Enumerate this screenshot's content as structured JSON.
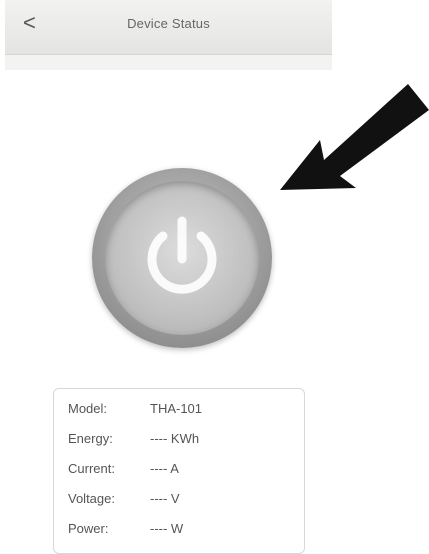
{
  "header": {
    "back_label": "<",
    "title": "Device Status"
  },
  "power_button": {
    "icon": "power-icon"
  },
  "annotation": {
    "icon": "arrow-pointer-icon",
    "color": "#111111"
  },
  "info": [
    {
      "label": "Model:",
      "value": "THA-101"
    },
    {
      "label": "Energy:",
      "value": "---- KWh"
    },
    {
      "label": "Current:",
      "value": "---- A"
    },
    {
      "label": "Voltage:",
      "value": "---- V"
    },
    {
      "label": "Power:",
      "value": "---- W"
    }
  ],
  "colors": {
    "header_bg": "#e8e8e6",
    "text": "#555555",
    "button_gray": "#a9a9a9"
  }
}
